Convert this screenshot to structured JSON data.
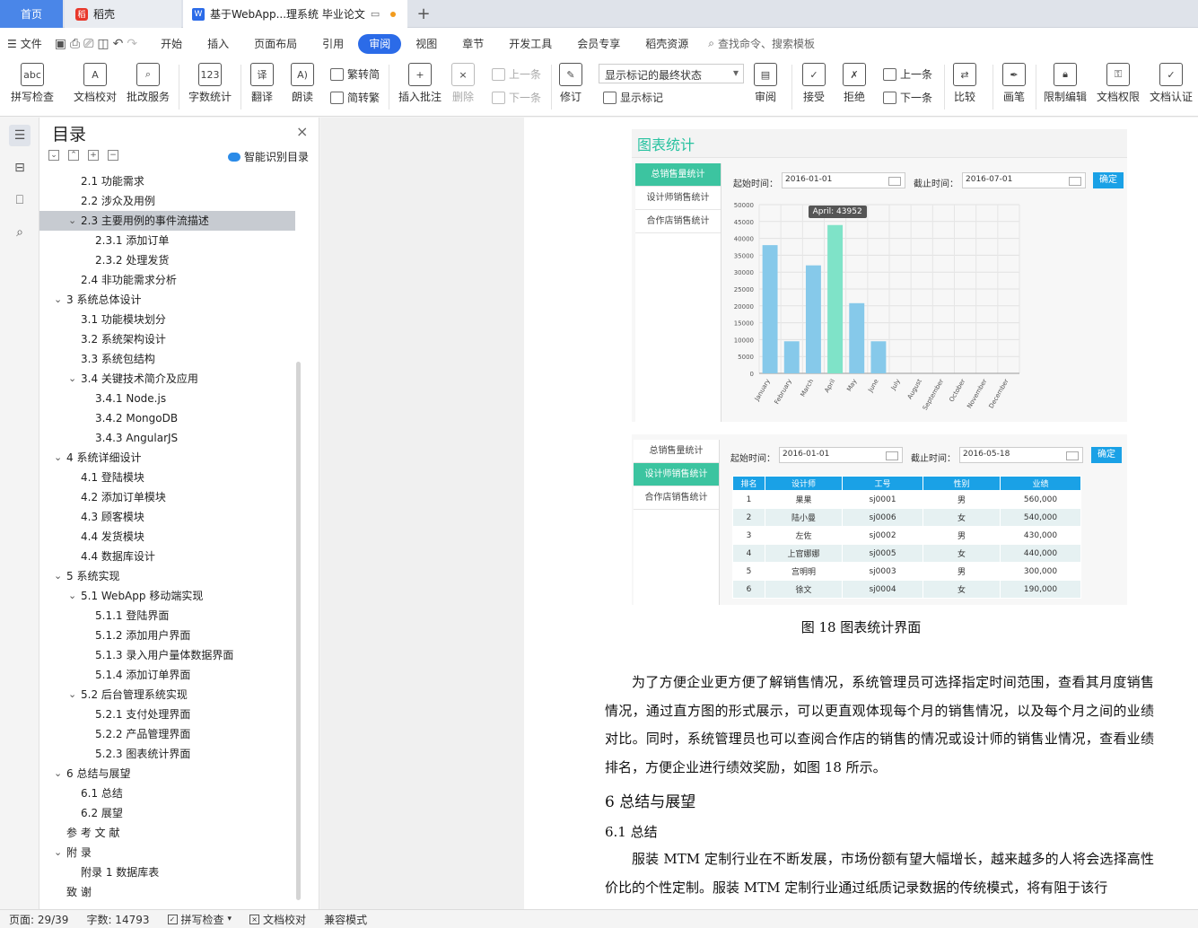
{
  "tabs": {
    "home": "首页",
    "wk": "稻壳",
    "doc": "基于WebApp...理系统 毕业论文"
  },
  "menu": {
    "file": "文件",
    "items": [
      "开始",
      "插入",
      "页面布局",
      "引用",
      "审阅",
      "视图",
      "章节",
      "开发工具",
      "会员专享",
      "稻壳资源"
    ],
    "active_index": 4,
    "search": "查找命令、搜索模板"
  },
  "ribbon": {
    "spell": "拼写检查",
    "proof": "文档校对",
    "service": "批改服务",
    "count": "字数统计",
    "translate": "翻译",
    "read": "朗读",
    "t2s": "繁转简",
    "s2t": "简转繁",
    "add_comment": "插入批注",
    "delete": "删除",
    "prev_c": "上一条",
    "next_c": "下一条",
    "revise": "修订",
    "show_mode": "显示标记的最终状态",
    "show_marks": "显示标记",
    "review": "审阅",
    "accept": "接受",
    "reject": "拒绝",
    "prev": "上一条",
    "next": "下一条",
    "compare": "比较",
    "pen": "画笔",
    "restrict": "限制编辑",
    "rights": "文档权限",
    "cert": "文档认证"
  },
  "toc": {
    "title": "目录",
    "smart": "智能识别目录",
    "items": [
      {
        "t": "2.1  功能需求",
        "lvl": 2,
        "tw": ""
      },
      {
        "t": "2.2  涉众及用例",
        "lvl": 2,
        "tw": ""
      },
      {
        "t": "2.3  主要用例的事件流描述",
        "lvl": 2,
        "tw": "open",
        "active": true
      },
      {
        "t": "2.3.1    添加订单",
        "lvl": 3,
        "tw": ""
      },
      {
        "t": "2.3.2    处理发货",
        "lvl": 3,
        "tw": ""
      },
      {
        "t": "2.4  非功能需求分析",
        "lvl": 2,
        "tw": ""
      },
      {
        "t": "3    系统总体设计",
        "lvl": 1,
        "tw": "open"
      },
      {
        "t": "3.1  功能模块划分",
        "lvl": 2,
        "tw": ""
      },
      {
        "t": "3.2  系统架构设计",
        "lvl": 2,
        "tw": ""
      },
      {
        "t": "3.3  系统包结构",
        "lvl": 2,
        "tw": ""
      },
      {
        "t": "3.4  关键技术简介及应用",
        "lvl": 2,
        "tw": "open"
      },
      {
        "t": "3.4.1    Node.js",
        "lvl": 3,
        "tw": ""
      },
      {
        "t": "3.4.2    MongoDB",
        "lvl": 3,
        "tw": ""
      },
      {
        "t": "3.4.3    AngularJS",
        "lvl": 3,
        "tw": ""
      },
      {
        "t": "4    系统详细设计",
        "lvl": 1,
        "tw": "open"
      },
      {
        "t": "4.1  登陆模块",
        "lvl": 2,
        "tw": ""
      },
      {
        "t": "4.2  添加订单模块",
        "lvl": 2,
        "tw": ""
      },
      {
        "t": "4.3  顾客模块",
        "lvl": 2,
        "tw": ""
      },
      {
        "t": "4.4  发货模块",
        "lvl": 2,
        "tw": ""
      },
      {
        "t": "4.4  数据库设计",
        "lvl": 2,
        "tw": ""
      },
      {
        "t": "5    系统实现",
        "lvl": 1,
        "tw": "open"
      },
      {
        "t": "5.1 WebApp 移动端实现",
        "lvl": 2,
        "tw": "open"
      },
      {
        "t": "5.1.1    登陆界面",
        "lvl": 3,
        "tw": ""
      },
      {
        "t": "5.1.2    添加用户界面",
        "lvl": 3,
        "tw": ""
      },
      {
        "t": "5.1.3    录入用户量体数据界面",
        "lvl": 3,
        "tw": ""
      },
      {
        "t": "5.1.4    添加订单界面",
        "lvl": 3,
        "tw": ""
      },
      {
        "t": "5.2  后台管理系统实现",
        "lvl": 2,
        "tw": "open"
      },
      {
        "t": "5.2.1    支付处理界面",
        "lvl": 3,
        "tw": ""
      },
      {
        "t": "5.2.2    产品管理界面",
        "lvl": 3,
        "tw": ""
      },
      {
        "t": "5.2.3    图表统计界面",
        "lvl": 3,
        "tw": ""
      },
      {
        "t": "6    总结与展望",
        "lvl": 1,
        "tw": "open"
      },
      {
        "t": "6.1  总结",
        "lvl": 2,
        "tw": ""
      },
      {
        "t": "6.2  展望",
        "lvl": 2,
        "tw": ""
      },
      {
        "t": "参 考 文 献",
        "lvl": 0,
        "tw": ""
      },
      {
        "t": "附          录",
        "lvl": 1,
        "tw": "open"
      },
      {
        "t": "附录 1     数据库表",
        "lvl": 2,
        "tw": ""
      },
      {
        "t": "致          谢",
        "lvl": 0,
        "tw": ""
      }
    ]
  },
  "fig1": {
    "title": "图表统计",
    "side": [
      "总销售量统计",
      "设计师销售统计",
      "合作店销售统计"
    ],
    "start_label": "起始时间：",
    "start": "2016-01-01",
    "end_label": "截止时间：",
    "end": "2016-07-01",
    "ok": "确定",
    "tooltip": "April: 43952"
  },
  "chart_data": {
    "type": "bar",
    "categories": [
      "January",
      "February",
      "March",
      "April",
      "May",
      "June",
      "July",
      "August",
      "September",
      "October",
      "November",
      "December"
    ],
    "values": [
      38000,
      9500,
      32000,
      43952,
      20800,
      9500,
      0,
      0,
      0,
      0,
      0,
      0
    ],
    "yticks": [
      0,
      5000,
      10000,
      15000,
      20000,
      25000,
      30000,
      35000,
      40000,
      45000,
      50000
    ],
    "ylim": [
      0,
      50000
    ],
    "highlight_index": 3,
    "bar_color": "#86c9ea",
    "highlight_color": "#7fe3c8",
    "grid": true
  },
  "fig2": {
    "side": [
      "总销售量统计",
      "设计师销售统计",
      "合作店销售统计"
    ],
    "start_label": "起始时间：",
    "start": "2016-01-01",
    "end_label": "截止时间：",
    "end": "2016-05-18",
    "ok": "确定",
    "headers": [
      "排名",
      "设计师",
      "工号",
      "性别",
      "业绩"
    ],
    "rows": [
      [
        "1",
        "果果",
        "sj0001",
        "男",
        "560,000"
      ],
      [
        "2",
        "陆小曼",
        "sj0006",
        "女",
        "540,000"
      ],
      [
        "3",
        "左佐",
        "sj0002",
        "男",
        "430,000"
      ],
      [
        "4",
        "上官娜娜",
        "sj0005",
        "女",
        "440,000"
      ],
      [
        "5",
        "宫明明",
        "sj0003",
        "男",
        "300,000"
      ],
      [
        "6",
        "徐文",
        "sj0004",
        "女",
        "190,000"
      ]
    ]
  },
  "doc": {
    "caption": "图 18  图表统计界面",
    "para1": "为了方便企业更方便了解销售情况，系统管理员可选择指定时间范围，查看其月度销售情况，通过直方图的形式展示，可以更直观体现每个月的销售情况，以及每个月之间的业绩对比。同时，系统管理员也可以查阅合作店的销售的情况或设计师的销售业情况，查看业绩排名，方便企业进行绩效奖励，如图 18 所示。",
    "h1": "6    总结与展望",
    "h2": "6.1  总结",
    "para2": "服装 MTM 定制行业在不断发展，市场份额有望大幅增长，越来越多的人将会选择高性价比的个性定制。服装 MTM 定制行业通过纸质记录数据的传统模式，将有阻于该行"
  },
  "status": {
    "page": "页面: 29/39",
    "words": "字数: 14793",
    "spell": "拼写检查",
    "proof": "文档校对",
    "compat": "兼容模式"
  }
}
